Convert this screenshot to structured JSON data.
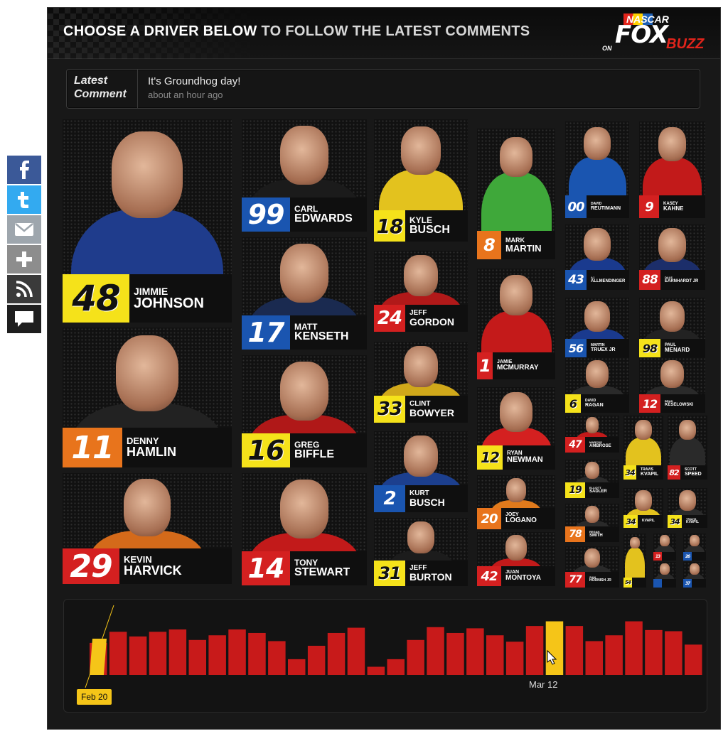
{
  "share": {
    "items": [
      {
        "name": "facebook-icon",
        "glyph": "f",
        "color": "#3b5998"
      },
      {
        "name": "twitter-icon",
        "glyph": "t",
        "color": "#33aaf0"
      },
      {
        "name": "email-icon",
        "glyph": "✉",
        "color": "#9ea6ad"
      },
      {
        "name": "more-icon",
        "glyph": "+",
        "color": "#8d8d8d"
      },
      {
        "name": "rss-icon",
        "glyph": "rss",
        "color": "#3a3a3a"
      },
      {
        "name": "comment-icon",
        "glyph": "msg",
        "color": "#1e1e1e"
      }
    ]
  },
  "header": {
    "title_a": "CHOOSE A DRIVER BELOW",
    "title_b": " TO FOLLOW THE LATEST COMMENTS",
    "logo": {
      "nascar": "NASCAR",
      "on": "ON",
      "fox": "FOX",
      "buzz": "BUZZ"
    }
  },
  "latest": {
    "label_1": "Latest",
    "label_2": "Comment",
    "text": "It's Groundhog day!",
    "time": "about an hour ago"
  },
  "drivers": [
    {
      "num": "48",
      "first": "JIMMIE",
      "last": "JOHNSON",
      "num_bg": "#f5e21a",
      "suit": "#1f3c8c"
    },
    {
      "num": "11",
      "first": "DENNY",
      "last": "HAMLIN",
      "num_bg": "#e8741c",
      "suit": "#222222"
    },
    {
      "num": "29",
      "first": "KEVIN",
      "last": "HARVICK",
      "num_bg": "#d42020",
      "suit": "#d46a1a"
    },
    {
      "num": "99",
      "first": "CARL",
      "last": "EDWARDS",
      "num_bg": "#1a55b0",
      "suit": "#1b1b1b"
    },
    {
      "num": "17",
      "first": "MATT",
      "last": "KENSETH",
      "num_bg": "#1a55b0",
      "suit": "#1a2a50"
    },
    {
      "num": "16",
      "first": "GREG",
      "last": "BIFFLE",
      "num_bg": "#f5e21a",
      "suit": "#b01818"
    },
    {
      "num": "14",
      "first": "TONY",
      "last": "STEWART",
      "num_bg": "#d42020",
      "suit": "#c21a1a"
    },
    {
      "num": "18",
      "first": "KYLE",
      "last": "BUSCH",
      "num_bg": "#f5e21a",
      "suit": "#e3c21e"
    },
    {
      "num": "24",
      "first": "JEFF",
      "last": "GORDON",
      "num_bg": "#d42020",
      "suit": "#b11919"
    },
    {
      "num": "33",
      "first": "CLINT",
      "last": "BOWYER",
      "num_bg": "#f5e21a",
      "suit": "#d0a81a"
    },
    {
      "num": "2",
      "first": "KURT",
      "last": "BUSCH",
      "num_bg": "#1a55b0",
      "suit": "#1c3f8e"
    },
    {
      "num": "31",
      "first": "JEFF",
      "last": "BURTON",
      "num_bg": "#f5e21a",
      "suit": "#1c1c1c"
    },
    {
      "num": "8",
      "first": "MARK",
      "last": "MARTIN",
      "num_bg": "#e8741c",
      "suit": "#3fa83a"
    },
    {
      "num": "1",
      "first": "JAMIE",
      "last": "MCMURRAY",
      "num_bg": "#d42020",
      "suit": "#c41a1a"
    },
    {
      "num": "12",
      "first": "RYAN",
      "last": "NEWMAN",
      "num_bg": "#f5e21a",
      "suit": "#d42020"
    },
    {
      "num": "20",
      "first": "JOEY",
      "last": "LOGANO",
      "num_bg": "#e8741c",
      "suit": "#e07a1c"
    },
    {
      "num": "42",
      "first": "JUAN",
      "last": "MONTOYA",
      "num_bg": "#d42020",
      "suit": "#c21a1a"
    },
    {
      "num": "00",
      "first": "DAVID",
      "last": "REUTIMANN",
      "num_bg": "#1a55b0",
      "suit": "#1a55b0"
    },
    {
      "num": "9",
      "first": "KASEY",
      "last": "KAHNE",
      "num_bg": "#d42020",
      "suit": "#c21a1a"
    },
    {
      "num": "43",
      "first": "AJ",
      "last": "ALLMENDINGER",
      "num_bg": "#1a55b0",
      "suit": "#1a3a8e"
    },
    {
      "num": "88",
      "first": "DALE",
      "last": "EARNHARDT JR",
      "num_bg": "#d42020",
      "suit": "#1c2e6a"
    },
    {
      "num": "56",
      "first": "MARTIN",
      "last": "TRUEX JR",
      "num_bg": "#1a55b0",
      "suit": "#1a3a8e"
    },
    {
      "num": "98",
      "first": "PAUL",
      "last": "MENARD",
      "num_bg": "#f5e21a",
      "suit": "#222222"
    },
    {
      "num": "6",
      "first": "DAVID",
      "last": "RAGAN",
      "num_bg": "#f5e21a",
      "suit": "#2a2a2a"
    },
    {
      "num": "12",
      "first": "BRAD",
      "last": "KESELOWSKI",
      "num_bg": "#d42020",
      "suit": "#2a2a2a"
    },
    {
      "num": "47",
      "first": "MARCOS",
      "last": "AMBROSE",
      "num_bg": "#d42020",
      "suit": "#c21a1a"
    },
    {
      "num": "19",
      "first": "ELLIOTT",
      "last": "SADLER",
      "num_bg": "#f5e21a",
      "suit": "#2a2a2a"
    },
    {
      "num": "78",
      "first": "REGAN",
      "last": "SMITH",
      "num_bg": "#e8741c",
      "suit": "#2a2a2a"
    },
    {
      "num": "77",
      "first": "SAM",
      "last": "HORNISH JR",
      "num_bg": "#d42020",
      "suit": "#2a2a2a"
    },
    {
      "num": "34",
      "first": "TRAVIS",
      "last": "KVAPIL",
      "num_bg": "#f5e21a",
      "suit": "#e3c21e"
    },
    {
      "num": "82",
      "first": "SCOTT",
      "last": "SPEED",
      "num_bg": "#d42020",
      "suit": "#2a2a2a"
    },
    {
      "num": "34",
      "first": "",
      "last": "KVAPIL",
      "num_bg": "#f5e21a",
      "suit": "#e3c21e"
    },
    {
      "num": "34",
      "first": "TRAVIS",
      "last": "KVAPIL",
      "num_bg": "#f5e21a",
      "suit": "#2a2a2a"
    },
    {
      "num": "54",
      "first": "",
      "last": "",
      "num_bg": "#f5e21a",
      "suit": "#e3c21e"
    },
    {
      "num": "13",
      "first": "",
      "last": "",
      "num_bg": "#d42020",
      "suit": "#2a2a2a"
    },
    {
      "num": "26",
      "first": "",
      "last": "",
      "num_bg": "#1a55b0",
      "suit": "#2a2a2a"
    },
    {
      "num": "37",
      "first": "",
      "last": "",
      "num_bg": "#1a55b0",
      "suit": "#2a2a2a"
    },
    {
      "num": "",
      "first": "",
      "last": "",
      "num_bg": "#1a55b0",
      "suit": "#2a2a2a"
    },
    {
      "num": "",
      "first": "",
      "last": "",
      "num_bg": "#1a55b0",
      "suit": "#2a2a2a"
    },
    {
      "num": "",
      "first": "",
      "last": "",
      "num_bg": "#1a55b0",
      "suit": "#2a2a2a"
    }
  ],
  "timeline": {
    "start_label": "Feb 20",
    "end_label": "Mar 12",
    "selected_index": 23,
    "values": [
      0.55,
      0.74,
      0.66,
      0.74,
      0.78,
      0.6,
      0.68,
      0.78,
      0.72,
      0.58,
      0.27,
      0.5,
      0.72,
      0.81,
      0.14,
      0.27,
      0.6,
      0.82,
      0.72,
      0.8,
      0.68,
      0.57,
      0.84,
      0.92,
      0.84,
      0.58,
      0.68,
      0.92,
      0.77,
      0.75,
      0.52
    ]
  },
  "colors": {
    "accent": "#f5c518",
    "bar": "#c81a1a",
    "bar_selected": "#f5c518"
  }
}
